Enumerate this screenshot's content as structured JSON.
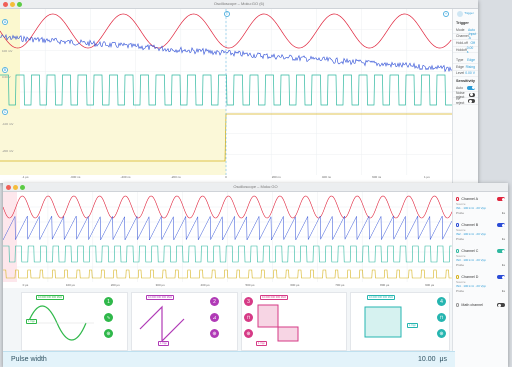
{
  "top_window": {
    "title": "Oscilloscope – Moku:GO (6)",
    "toolbar_tag": "Trigger",
    "y_labels": [
      "100 mV",
      "0.00 V",
      "-100 mV",
      "-200 mV"
    ],
    "ch_badges": [
      "A",
      "B",
      "C"
    ],
    "time_ticks": [
      "-1 μs",
      "-600 ns",
      "-400 ns",
      "-200 ns",
      "0",
      "200 ns",
      "400 ns",
      "600 ns",
      "1 μs"
    ],
    "panel": {
      "trigger_header": "Trigger",
      "rows": [
        {
          "label": "Mode",
          "value": "Auto"
        },
        {
          "label": "Channel",
          "value": "Input A"
        },
        {
          "label": "Hold-off",
          "value": "Off"
        },
        {
          "label": "Holdoff",
          "value": "0.00 s"
        }
      ],
      "type_rows": [
        {
          "label": "Type",
          "value": "Edge"
        },
        {
          "label": "Edge",
          "value": "Rising"
        },
        {
          "label": "Level",
          "value": "0.00 V"
        }
      ],
      "sens_header": "Sensitivity",
      "toggles": [
        {
          "label": "Auto",
          "on": true
        },
        {
          "label": "Noise reject",
          "on": false
        },
        {
          "label": "HF reject",
          "on": false
        }
      ]
    }
  },
  "bottom_window": {
    "title": "Oscilloscope – Moku:GO",
    "time_ticks": [
      "0 μs",
      "100 μs",
      "200 μs",
      "300 μs",
      "400 μs",
      "500 μs",
      "600 μs",
      "700 μs",
      "800 μs",
      "900 μs"
    ],
    "generators": [
      {
        "name": "Sine",
        "color": "#2fb84a",
        "freq": "10.000 000 000 MHz",
        "amp": "1 Vpp",
        "buttons": [
          "1",
          "∿",
          "⊕"
        ]
      },
      {
        "name": "Ramp",
        "color": "#b03ab6",
        "freq": "10.000 000 000 MHz",
        "amp": "1 Vpp",
        "buttons": [
          "2",
          "⊿",
          "⊕"
        ]
      },
      {
        "name": "Pulse",
        "color": "#d63a86",
        "freq": "10.000 000 000 MHz",
        "amp": "1 Vpp",
        "buttons": [
          "3",
          "⊓",
          "⊕"
        ]
      },
      {
        "name": "Pulse",
        "color": "#26b5b0",
        "freq": "10.000 000 000 MHz",
        "amp": "1 Vpp",
        "buttons": [
          "4",
          "⊓",
          "⊕"
        ]
      }
    ],
    "channels": [
      {
        "name": "Channel A",
        "color": "#e0253d",
        "on": true,
        "source": "IN1 · 100 k Ω · 20 Vpp",
        "probe": "1x"
      },
      {
        "name": "Channel B",
        "color": "#2b4cd6",
        "on": true,
        "source": "IN2 · 100 k Ω · 20 Vpp",
        "probe": "1x"
      },
      {
        "name": "Channel C",
        "color": "#2fb8a0",
        "on": true,
        "source": "IN3 · 100 k Ω · 20 Vpp",
        "probe": "1x"
      },
      {
        "name": "Channel D",
        "color": "#d6b31f",
        "on": true,
        "source": "IN4 · 100 k Ω · 20 Vpp",
        "probe": "1x"
      }
    ],
    "math_label": "Math channel",
    "probe_label": "Probe",
    "source_label": "Source"
  },
  "pulse_width": {
    "label": "Pulse width",
    "value": "10.00",
    "unit": "μs"
  },
  "colors": {
    "red": "#e0253d",
    "blue": "#2b4cd6",
    "green": "#2fb8a0",
    "yellow": "#d6b31f",
    "accent": "#2a9bd6"
  }
}
